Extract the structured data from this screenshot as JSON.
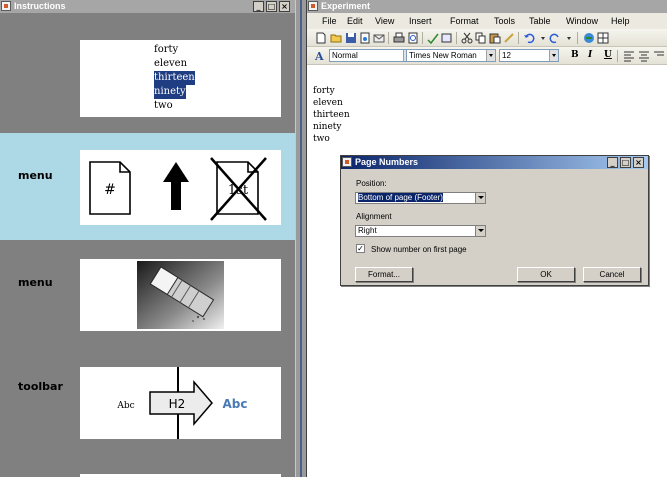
{
  "instructions_window": {
    "title": "Instructions",
    "controls": {
      "minimize": "_",
      "maximize": "□",
      "close": "×"
    },
    "word_list": [
      {
        "text": "forty",
        "selected": false
      },
      {
        "text": "eleven",
        "selected": false
      },
      {
        "text": "thirteen",
        "selected": true
      },
      {
        "text": "ninety",
        "selected": true
      },
      {
        "text": "two",
        "selected": false
      }
    ],
    "steps": [
      {
        "label": "menu",
        "icons": [
          "page-number-icon",
          "up-arrow-icon",
          "crossed-out-first-page-icon"
        ],
        "page_glyph": "#",
        "crossed_glyph": "1st"
      },
      {
        "label": "menu",
        "icons": [
          "eraser-icon"
        ]
      },
      {
        "label": "toolbar",
        "abc_plain": "Abc",
        "h2_text": "H2",
        "abc_styled": "Abc"
      }
    ]
  },
  "experiment_window": {
    "title": "Experiment",
    "menu": [
      "File",
      "Edit",
      "View",
      "Insert",
      "Format",
      "Tools",
      "Table",
      "Window",
      "Help"
    ],
    "formatting": {
      "style": "Normal",
      "font": "Times New Roman",
      "size": "12",
      "bold": "B",
      "italic": "I",
      "underline": "U"
    },
    "document_lines": [
      "forty",
      "eleven",
      "thirteen",
      "ninety",
      "two"
    ]
  },
  "dialog": {
    "title": "Page Numbers",
    "position_label": "Position:",
    "position_value": "Bottom of page (Footer)",
    "alignment_label": "Alignment",
    "alignment_value": "Right",
    "show_first_label": "Show number on first page",
    "show_first_checked": true,
    "check_mark": "✓",
    "format_button": "Format...",
    "ok_button": "OK",
    "cancel_button": "Cancel"
  },
  "colors": {
    "selection": "#1f3d83",
    "highlight_panel": "#add8e6",
    "dialog_title": "#0a246a",
    "accent_text": "#4a7ab5"
  }
}
